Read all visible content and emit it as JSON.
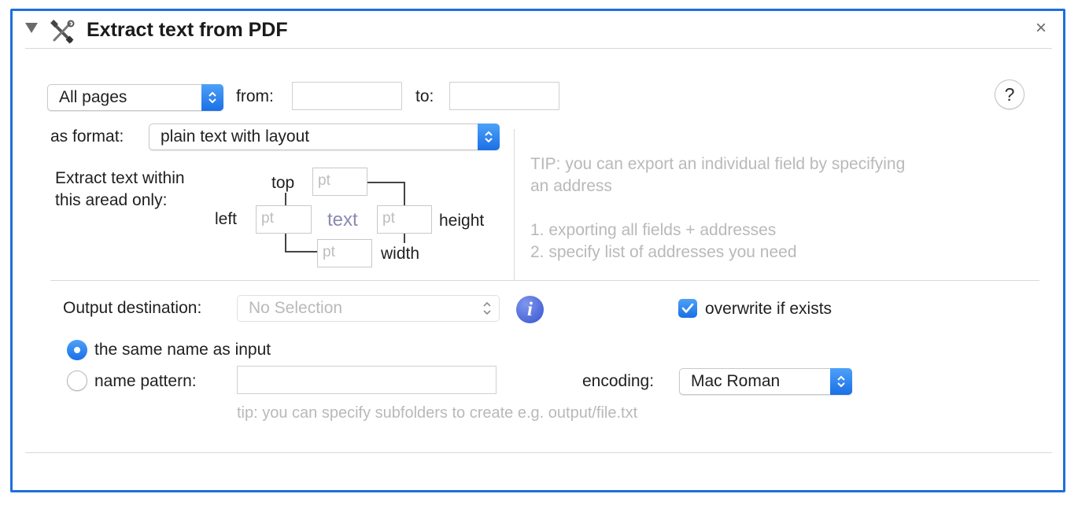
{
  "action": {
    "title": "Extract text from PDF",
    "close_glyph": "×",
    "icons": {
      "title_icon": "tools-icon",
      "disclosure": "disclosure-triangle-icon",
      "close": "close-icon"
    }
  },
  "pages": {
    "selected": "All pages",
    "from_label": "from:",
    "from_value": "",
    "to_label": "to:",
    "to_value": ""
  },
  "help_glyph": "?",
  "format": {
    "label": "as format:",
    "selected": "plain text with layout"
  },
  "area": {
    "label_line1": "Extract text within",
    "label_line2": "this aread only:",
    "top_label": "top",
    "left_label": "left",
    "height_label": "height",
    "width_label": "width",
    "center_label": "text",
    "placeholder": "pt"
  },
  "tip": {
    "line1": "TIP: you can export an individual field by specifying",
    "line2": "an address",
    "line3": "1. exporting all fields + addresses",
    "line4": "2. specify list of addresses you need"
  },
  "output": {
    "label": "Output destination:",
    "selected": "No Selection",
    "info_glyph": "i",
    "overwrite_label": "overwrite if exists",
    "overwrite_checked": true,
    "same_name_label": "the same name as input",
    "same_name_selected": true,
    "pattern_label": "name pattern:",
    "pattern_value": "",
    "encoding_label": "encoding:",
    "encoding_selected": "Mac Roman",
    "pattern_tip": "tip: you can specify subfolders to create e.g. output/file.txt"
  },
  "colors": {
    "accent": "#1d6fdc",
    "tip_text": "#b9b9b9",
    "center_label": "#8a8ab0"
  }
}
